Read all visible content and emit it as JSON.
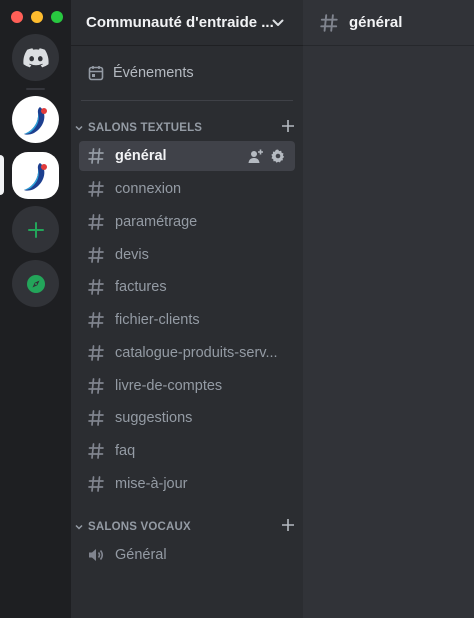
{
  "window": {
    "traffic_lights": {
      "close": "#ff5f57",
      "minimize": "#febc2e",
      "zoom": "#28c840"
    }
  },
  "server_rail": {
    "items": [
      {
        "name": "discord-home",
        "icon": "discord-logo-icon"
      },
      {
        "name": "server-1",
        "icon": "server-logo"
      },
      {
        "name": "server-2",
        "icon": "server-logo",
        "selected": true
      },
      {
        "name": "add-server",
        "icon": "plus-icon"
      },
      {
        "name": "explore",
        "icon": "compass-icon"
      }
    ],
    "accent_green": "#23a55a"
  },
  "server": {
    "name": "Communauté d'entraide ..."
  },
  "events": {
    "label": "Événements"
  },
  "text_category": {
    "label": "SALONS TEXTUELS",
    "channels": [
      {
        "label": "général",
        "active": true
      },
      {
        "label": "connexion"
      },
      {
        "label": "paramétrage"
      },
      {
        "label": "devis"
      },
      {
        "label": "factures"
      },
      {
        "label": "fichier-clients"
      },
      {
        "label": "catalogue-produits-serv..."
      },
      {
        "label": "livre-de-comptes"
      },
      {
        "label": "suggestions"
      },
      {
        "label": "faq"
      },
      {
        "label": "mise-à-jour"
      }
    ]
  },
  "voice_category": {
    "label": "SALONS VOCAUX",
    "channels": [
      {
        "label": "Général"
      }
    ]
  },
  "main": {
    "channel_title": "général"
  }
}
